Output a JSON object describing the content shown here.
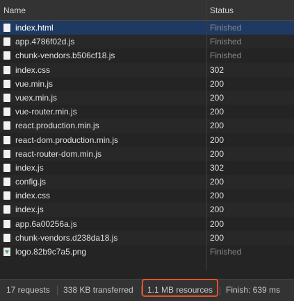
{
  "table": {
    "columns": {
      "name": "Name",
      "status": "Status"
    },
    "rows": [
      {
        "name": "index.html",
        "status": "Finished",
        "icon": "document-icon",
        "selected": true
      },
      {
        "name": "app.4786f02d.js",
        "status": "Finished",
        "icon": "document-icon"
      },
      {
        "name": "chunk-vendors.b506cf18.js",
        "status": "Finished",
        "icon": "document-icon"
      },
      {
        "name": "index.css",
        "status": "302",
        "icon": "document-icon"
      },
      {
        "name": "vue.min.js",
        "status": "200",
        "icon": "document-icon"
      },
      {
        "name": "vuex.min.js",
        "status": "200",
        "icon": "document-icon"
      },
      {
        "name": "vue-router.min.js",
        "status": "200",
        "icon": "document-icon"
      },
      {
        "name": "react.production.min.js",
        "status": "200",
        "icon": "document-icon"
      },
      {
        "name": "react-dom.production.min.js",
        "status": "200",
        "icon": "document-icon"
      },
      {
        "name": "react-router-dom.min.js",
        "status": "200",
        "icon": "document-icon"
      },
      {
        "name": "index.js",
        "status": "302",
        "icon": "document-icon"
      },
      {
        "name": "config.js",
        "status": "200",
        "icon": "document-icon"
      },
      {
        "name": "index.css",
        "status": "200",
        "icon": "document-icon"
      },
      {
        "name": "index.js",
        "status": "200",
        "icon": "document-icon"
      },
      {
        "name": "app.6a00256a.js",
        "status": "200",
        "icon": "document-icon"
      },
      {
        "name": "chunk-vendors.d238da18.js",
        "status": "200",
        "icon": "document-icon"
      },
      {
        "name": "logo.82b9c7a5.png",
        "status": "Finished",
        "icon": "image-icon"
      }
    ]
  },
  "footer": {
    "requests": "17 requests",
    "transferred": "338 KB transferred",
    "resources": "1.1 MB resources",
    "finish": "Finish: 639 ms"
  },
  "colors": {
    "selected_row": "#1e3a63",
    "highlight": "#e2512a",
    "muted_status": "#8a8a8a"
  }
}
